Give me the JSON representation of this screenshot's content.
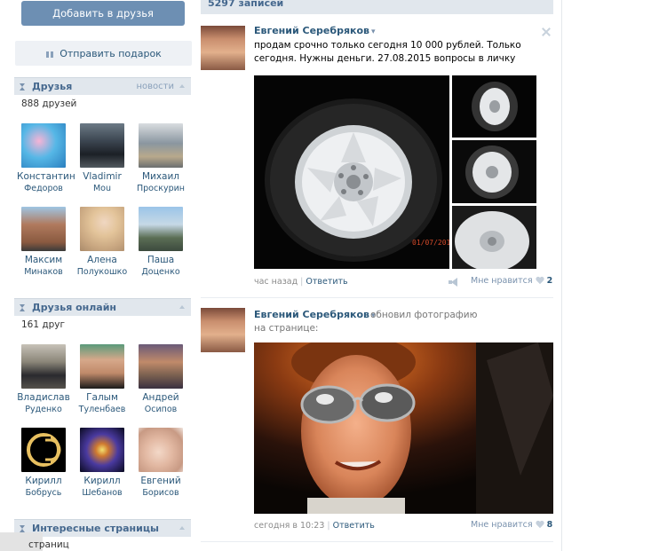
{
  "profile": {
    "add_friend_label": "Добавить в друзья",
    "send_gift_label": "Отправить подарок"
  },
  "friends": {
    "title": "Друзья",
    "link": "новости",
    "count": "888 друзей",
    "items": [
      {
        "first": "Константин",
        "last": "Федоров"
      },
      {
        "first": "Vladimir",
        "last": "Mou"
      },
      {
        "first": "Михаил",
        "last": "Проскурин"
      },
      {
        "first": "Максим",
        "last": "Минаков"
      },
      {
        "first": "Алена",
        "last": "Полукошко"
      },
      {
        "first": "Паша",
        "last": "Доценко"
      }
    ]
  },
  "friends_online": {
    "title": "Друзья онлайн",
    "count": "161 друг",
    "items": [
      {
        "first": "Владислав",
        "last": "Руденко"
      },
      {
        "first": "Галым",
        "last": "Туленбаев"
      },
      {
        "first": "Андрей",
        "last": "Осипов"
      },
      {
        "first": "Кирилл",
        "last": "Бобрусь"
      },
      {
        "first": "Кирилл",
        "last": "Шебанов"
      },
      {
        "first": "Евгений",
        "last": "Борисов"
      }
    ]
  },
  "interesting": {
    "title": "Интересные страницы",
    "count": "страниц"
  },
  "wall": {
    "count": "5297 записей",
    "posts": [
      {
        "author": "Евгений Серебряков",
        "text": "продам срочно только сегодня 10 000 рублей. Только сегодня. Нужны деньги. 27.08.2015 вопросы в личку",
        "photo_stamp": "01/07/201",
        "time": "час назад",
        "reply": "Ответить",
        "like_label": "Мне нравится",
        "likes": "2"
      },
      {
        "author": "Евгений Серебряков",
        "text": "обновил фотографию на странице:",
        "time": "сегодня в 10:23",
        "reply": "Ответить",
        "like_label": "Мне нравится",
        "likes": "8"
      }
    ]
  },
  "icons": {
    "dropdown": "▾",
    "gift": "gift-icon",
    "close": "close-icon",
    "heart": "heart-icon",
    "share": "megaphone-icon"
  },
  "colors": {
    "accent": "#6d8fb3",
    "link": "#2b587a",
    "header_bg": "#e1e7ed"
  }
}
